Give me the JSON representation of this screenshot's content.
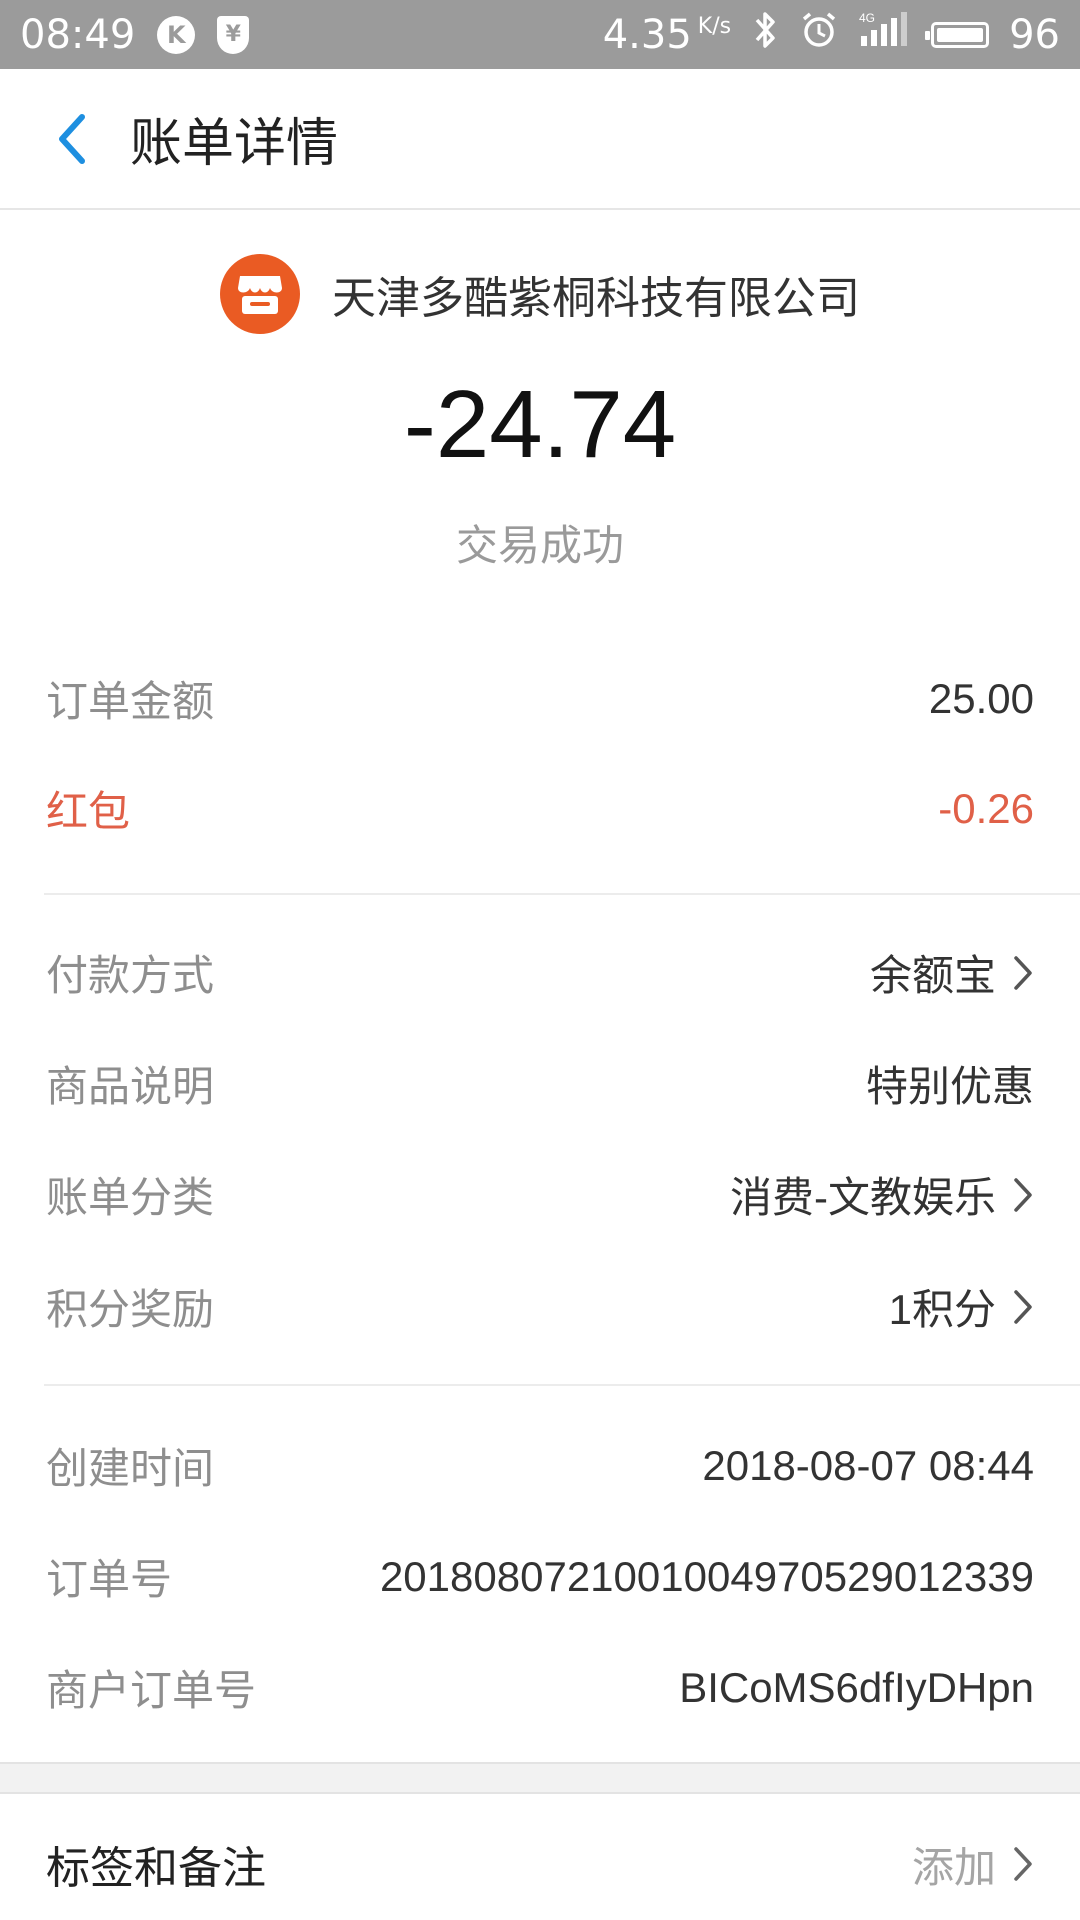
{
  "status_bar": {
    "time": "08:49",
    "k_badge": "K",
    "yen_badge": "¥",
    "net_speed": "4.35",
    "net_speed_unit": "K/s",
    "network_type": "4G",
    "battery": "96"
  },
  "header": {
    "title": "账单详情",
    "back_icon": "chevron-left-icon"
  },
  "merchant": {
    "name": "天津多酷紫桐科技有限公司",
    "logo_icon": "shop-icon",
    "logo_color": "#ea5b23"
  },
  "amount": "-24.74",
  "status": "交易成功",
  "order_amount": {
    "label": "订单金额",
    "value": "25.00"
  },
  "red_packet": {
    "label": "红包",
    "value": "-0.26",
    "color": "#e06048"
  },
  "details": [
    {
      "label": "付款方式",
      "value": "余额宝",
      "has_arrow": true
    },
    {
      "label": "商品说明",
      "value": "特别优惠",
      "has_arrow": false
    },
    {
      "label": "账单分类",
      "value": "消费-文教娱乐",
      "has_arrow": true
    },
    {
      "label": "积分奖励",
      "value": "1积分",
      "has_arrow": true
    }
  ],
  "meta": [
    {
      "label": "创建时间",
      "value": "2018-08-07 08:44"
    },
    {
      "label": "订单号",
      "value": "2018080721001004970529012339"
    },
    {
      "label": "商户订单号",
      "value": "BICoMS6dfIyDHpn"
    }
  ],
  "footer": {
    "label": "标签和备注",
    "action": "添加"
  }
}
